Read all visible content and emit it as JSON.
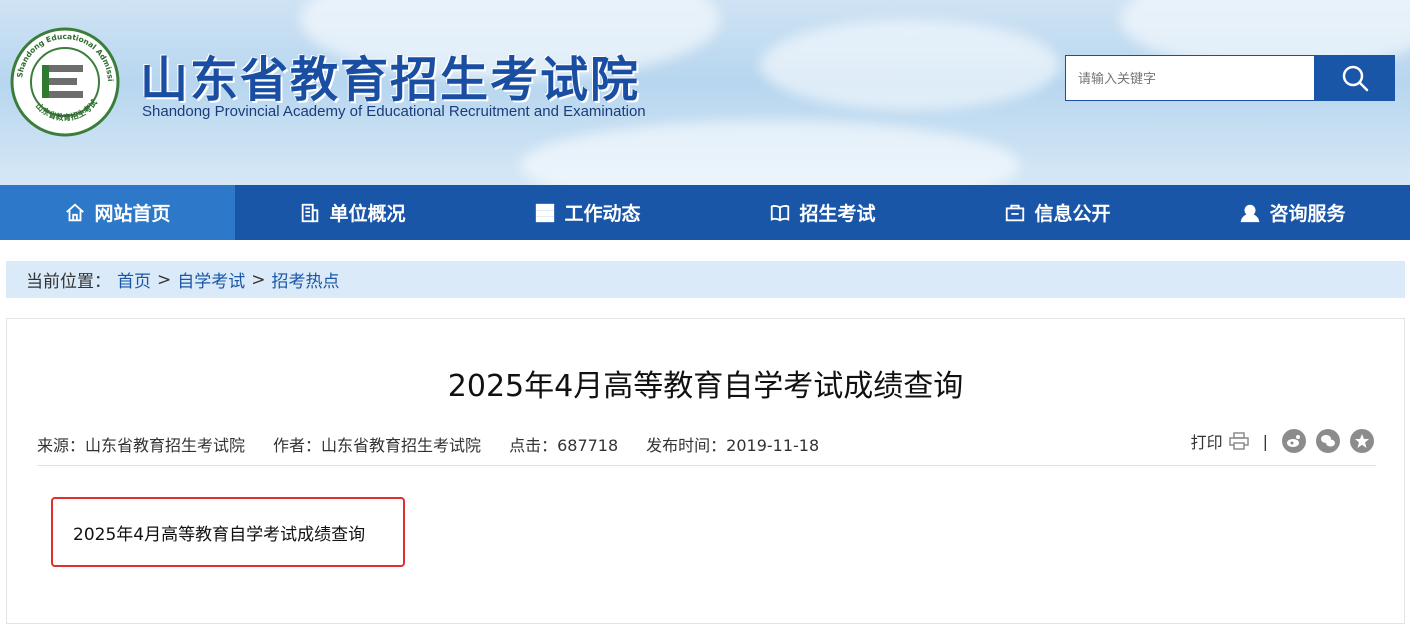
{
  "header": {
    "site_title_cn": "山东省教育招生考试院",
    "site_title_en": "Shandong Provincial Academy of Educational Recruitment and Examination",
    "logo_ring_text": "Shandong Educational Admission & Examination",
    "logo_bottom_text": "山东省教育招生考试",
    "logo_icon": "e-letter-logo",
    "search": {
      "placeholder": "请输入关键字",
      "button_icon": "search-icon"
    }
  },
  "nav": {
    "items": [
      {
        "label": "网站首页",
        "icon": "home-icon",
        "active": true
      },
      {
        "label": "单位概况",
        "icon": "building-icon"
      },
      {
        "label": "工作动态",
        "icon": "server-icon"
      },
      {
        "label": "招生考试",
        "icon": "book-icon"
      },
      {
        "label": "信息公开",
        "icon": "folder-icon"
      },
      {
        "label": "咨询服务",
        "icon": "user-service-icon"
      }
    ]
  },
  "breadcrumb": {
    "prefix": "当前位置：",
    "items": [
      "首页",
      "自学考试",
      "招考热点"
    ],
    "separator": ">"
  },
  "article": {
    "title": "2025年4月高等教育自学考试成绩查询",
    "meta": {
      "source_label": "来源：",
      "source": "山东省教育招生考试院",
      "author_label": "作者：",
      "author": "山东省教育招生考试院",
      "clicks_label": "点击：",
      "clicks": "687718",
      "date_label": "发布时间：",
      "date": "2019-11-18"
    },
    "tools": {
      "print_label": "打印",
      "separator": "|",
      "share_icons": [
        "weibo-icon",
        "wechat-icon",
        "star-icon"
      ]
    },
    "link_text": "2025年4月高等教育自学考试成绩查询"
  },
  "colors": {
    "primary": "#1a56a8",
    "nav_active": "#2d78c8",
    "breadcrumb_bg": "#dbeaf9",
    "highlight_border": "#e0302d"
  }
}
